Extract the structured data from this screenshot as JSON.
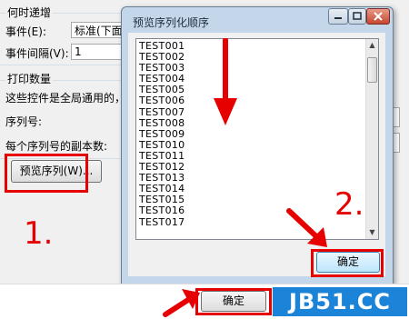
{
  "settings": {
    "increment_group_title": "何时递增",
    "event_label": "事件(E):",
    "event_value": "标准(下面的",
    "interval_label": "事件间隔(V):",
    "interval_value": "1",
    "print_group_title": "打印数量",
    "print_desc": "这些控件是全局通用的，",
    "serial_label": "序列号:",
    "copies_label": "每个序列号的副本数:",
    "preview_button": "预览序列(W)..."
  },
  "dialog": {
    "title": "预览序列化顺序",
    "items": [
      "TEST001",
      "TEST002",
      "TEST003",
      "TEST004",
      "TEST005",
      "TEST006",
      "TEST007",
      "TEST008",
      "TEST009",
      "TEST010",
      "TEST011",
      "TEST012",
      "TEST013",
      "TEST014",
      "TEST015",
      "TEST016",
      "TEST017"
    ],
    "ok_button": "确定"
  },
  "annotations": {
    "step1": "1.",
    "step2": "2.",
    "color": "#e60000"
  },
  "main": {
    "ok_button": "确定"
  },
  "watermark": {
    "text": "JB51.CC",
    "background": "#1b84d8"
  }
}
